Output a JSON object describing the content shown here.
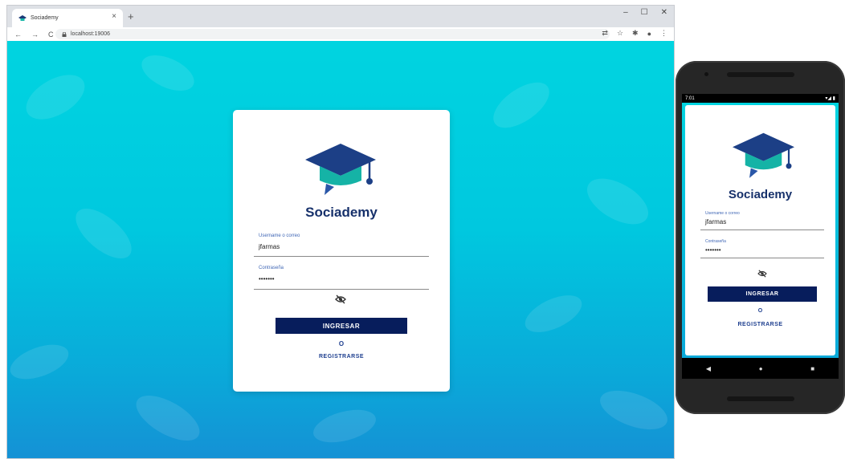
{
  "browser": {
    "tab_title": "Sociademy",
    "tab_close": "×",
    "new_tab": "+",
    "window_controls": {
      "minimize": "–",
      "maximize": "☐",
      "close": "✕"
    },
    "nav": {
      "back": "←",
      "forward": "→",
      "reload": "C"
    },
    "url": "localhost:19006",
    "tools": {
      "translate": "⇄",
      "star": "☆",
      "extensions": "✱",
      "profile": "●",
      "menu": "⋮"
    }
  },
  "app": {
    "brand": "Sociademy",
    "username_label": "Username o correo",
    "username_value": "jfarmas",
    "password_label": "Contraseña",
    "password_value": "•••••••",
    "login_button": "INGRESAR",
    "or_text": "O",
    "register_link": "REGISTRARSE",
    "colors": {
      "navy": "#071d5c",
      "brand_text": "#17316b",
      "accent_cyan": "#00d4e0",
      "link": "#1e3f8f"
    }
  },
  "phone": {
    "time": "7:01",
    "status_icons": "▾◢ ▮",
    "nav": {
      "back": "◀",
      "home": "●",
      "recents": "■"
    }
  }
}
